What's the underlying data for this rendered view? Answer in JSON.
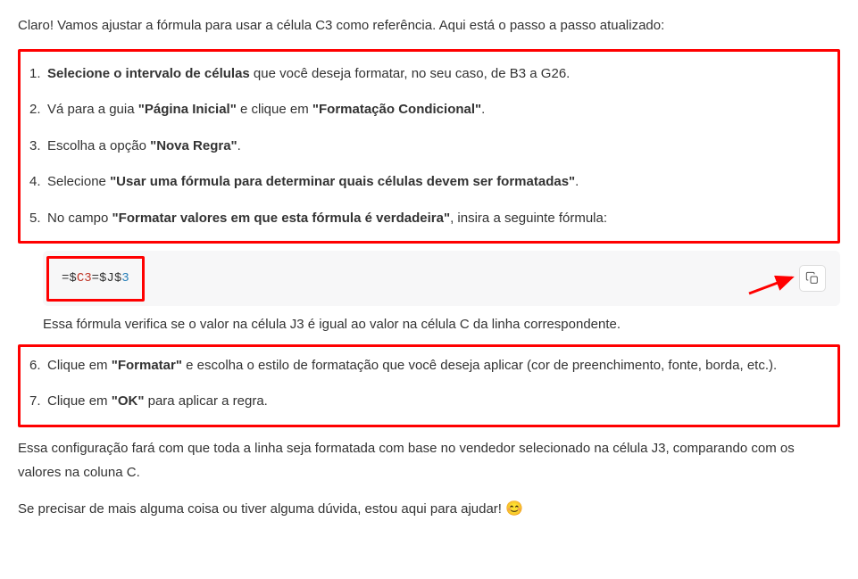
{
  "intro": "Claro! Vamos ajustar a fórmula para usar a célula C3 como referência. Aqui está o passo a passo atualizado:",
  "steps_a": [
    {
      "num": "1.",
      "pre": "",
      "b1": "Selecione o intervalo de células",
      "mid": " que você deseja formatar, no seu caso, de B3 a G26.",
      "b2": "",
      "post": ""
    },
    {
      "num": "2.",
      "pre": "Vá para a guia ",
      "b1": "\"Página Inicial\"",
      "mid": " e clique em ",
      "b2": "\"Formatação Condicional\"",
      "post": "."
    },
    {
      "num": "3.",
      "pre": "Escolha a opção ",
      "b1": "\"Nova Regra\"",
      "mid": ".",
      "b2": "",
      "post": ""
    },
    {
      "num": "4.",
      "pre": "Selecione ",
      "b1": "\"Usar uma fórmula para determinar quais células devem ser formatadas\"",
      "mid": ".",
      "b2": "",
      "post": ""
    },
    {
      "num": "5.",
      "pre": "No campo ",
      "b1": "\"Formatar valores em que esta fórmula é verdadeira\"",
      "mid": ", insira a seguinte fórmula:",
      "b2": "",
      "post": ""
    }
  ],
  "code": {
    "p1": "=$",
    "p2": "C3",
    "p3": "=$J$",
    "p4": "3"
  },
  "explain": "Essa fórmula verifica se o valor na célula J3 é igual ao valor na célula C da linha correspondente.",
  "steps_b": [
    {
      "num": "6.",
      "pre": "Clique em ",
      "b1": "\"Formatar\"",
      "mid": " e escolha o estilo de formatação que você deseja aplicar (cor de preenchimento, fonte, borda, etc.).",
      "b2": "",
      "post": ""
    },
    {
      "num": "7.",
      "pre": "Clique em ",
      "b1": "\"OK\"",
      "mid": " para aplicar a regra.",
      "b2": "",
      "post": ""
    }
  ],
  "outro": "Essa configuração fará com que toda a linha seja formatada com base no vendedor selecionado na célula J3, comparando com os valores na coluna C.",
  "closing": "Se precisar de mais alguma coisa ou tiver alguma dúvida, estou aqui para ajudar! ",
  "emoji": "😊"
}
